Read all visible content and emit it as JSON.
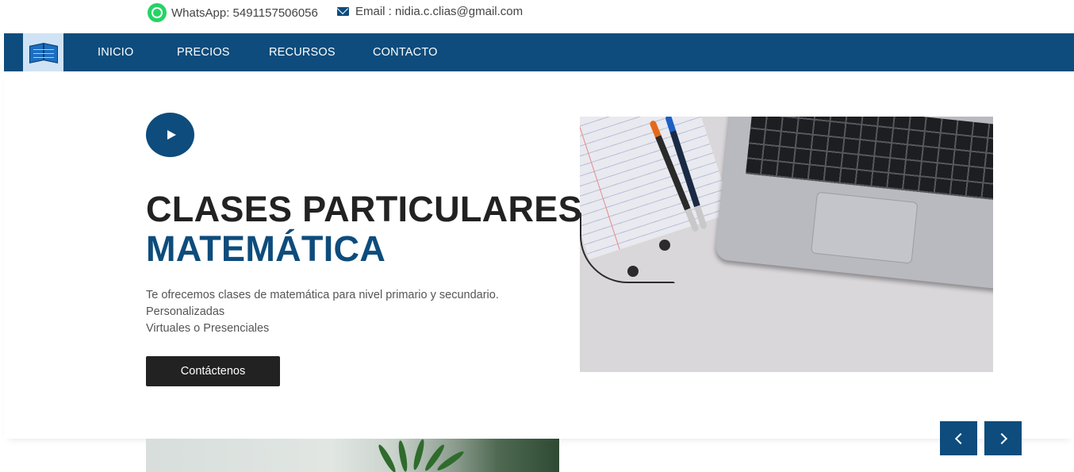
{
  "topbar": {
    "whatsapp_icon": "whatsapp-icon",
    "whatsapp_text": "WhatsApp: 5491157506056",
    "email_icon": "envelope-icon",
    "email_text": "Email : nidia.c.clias@gmail.com"
  },
  "nav": {
    "logo_icon": "book-logo-icon",
    "items": [
      {
        "label": "INICIO"
      },
      {
        "label": "PRECIOS"
      },
      {
        "label": "RECURSOS"
      },
      {
        "label": "CONTACTO"
      }
    ]
  },
  "hero": {
    "play_icon": "play-icon",
    "title_line1": "CLASES PARTICULARES",
    "title_line2": "MATEMÁTICA",
    "description": [
      "Te ofrecemos clases de matemática para nivel primario y secundario.",
      "Personalizadas",
      "Virtuales o Presenciales"
    ],
    "cta_label": "Contáctenos"
  },
  "carousel": {
    "prev_icon": "chevron-left-icon",
    "next_icon": "chevron-right-icon"
  },
  "colors": {
    "primary": "#0d4c7c",
    "dark": "#222222",
    "whatsapp": "#25d366"
  }
}
